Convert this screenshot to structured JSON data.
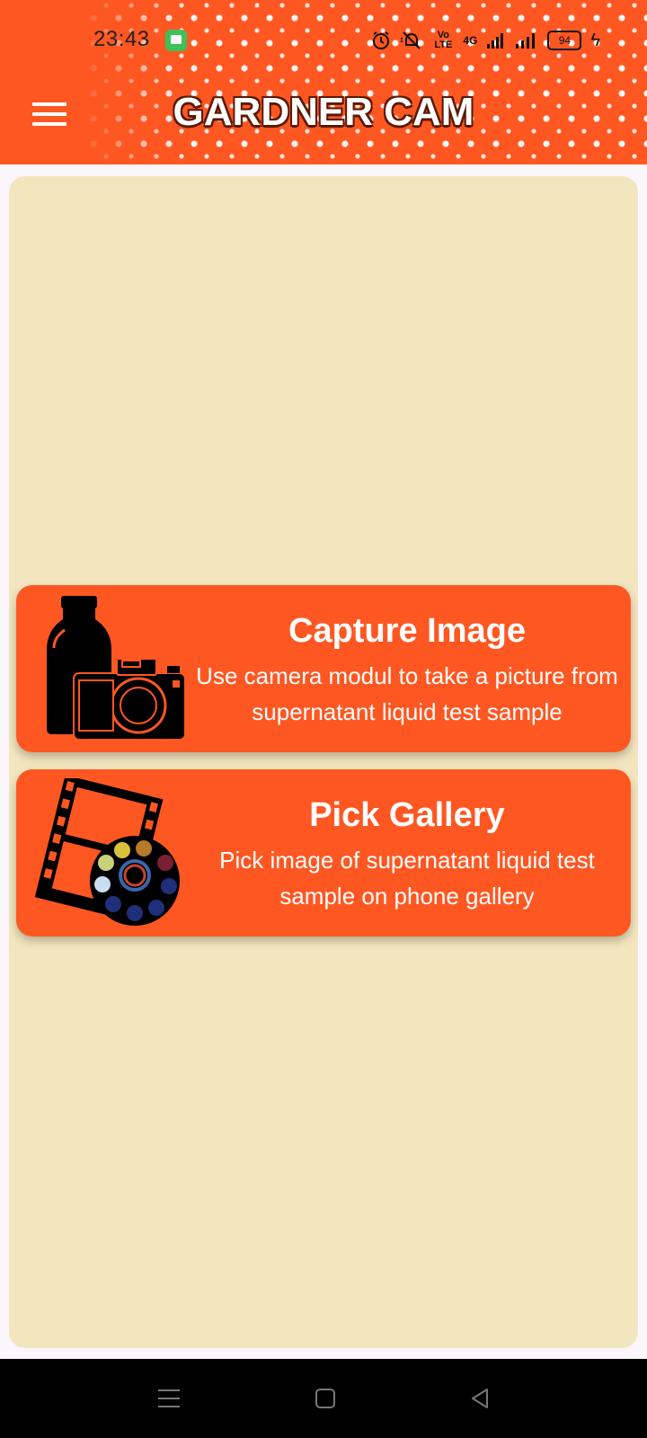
{
  "status_bar": {
    "time": "23:43",
    "battery": "94",
    "network": "4G",
    "volte": "Vo LTE"
  },
  "app_bar": {
    "title": "GARDNER CAM"
  },
  "cards": [
    {
      "title": "Capture Image",
      "description": "Use camera modul to take a picture from supernatant liquid test sample",
      "icon": "bottle-camera-icon"
    },
    {
      "title": "Pick Gallery",
      "description": "Pick image of supernatant liquid test sample on phone gallery",
      "icon": "film-palette-icon"
    }
  ],
  "colors": {
    "accent": "#ff5722",
    "panel": "#f3e6bf",
    "title_outline": "#5a1a05"
  },
  "nav_bar": {
    "buttons": [
      "recent-apps",
      "home",
      "back"
    ]
  }
}
